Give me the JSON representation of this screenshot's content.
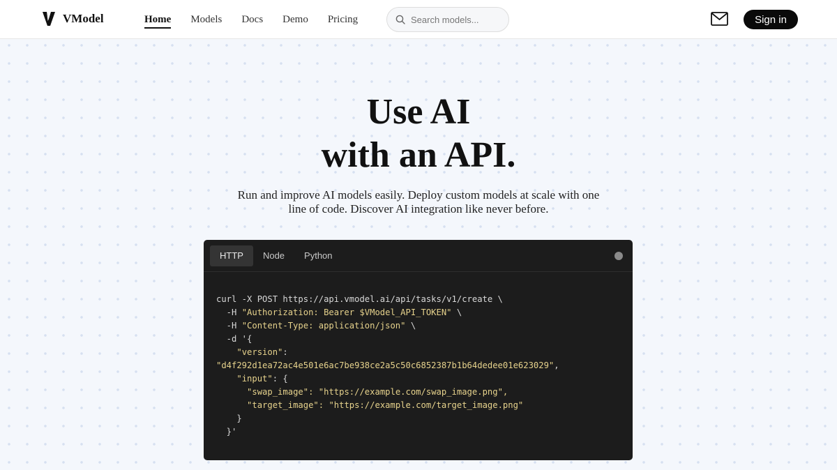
{
  "header": {
    "brand": "VModel",
    "nav": [
      {
        "label": "Home",
        "active": true
      },
      {
        "label": "Models",
        "active": false
      },
      {
        "label": "Docs",
        "active": false
      },
      {
        "label": "Demo",
        "active": false
      },
      {
        "label": "Pricing",
        "active": false
      }
    ],
    "search_placeholder": "Search models...",
    "mail_icon": "mail-icon",
    "signin_label": "Sign in"
  },
  "hero": {
    "title_line1": "Use AI",
    "title_line2": "with an API.",
    "subtitle": "Run and improve AI models easily. Deploy custom models at scale with one line of code. Discover AI integration like never before."
  },
  "code_panel": {
    "tabs": [
      {
        "label": "HTTP",
        "active": true
      },
      {
        "label": "Node",
        "active": false
      },
      {
        "label": "Python",
        "active": false
      }
    ],
    "lines": [
      {
        "pre": "curl -X POST https://api.vmodel.ai/api/tasks/v1/create \\",
        "str": "",
        "post": ""
      },
      {
        "pre": "  -H ",
        "str": "\"Authorization: Bearer $VModel_API_TOKEN\"",
        "post": " \\"
      },
      {
        "pre": "  -H ",
        "str": "\"Content-Type: application/json\"",
        "post": " \\"
      },
      {
        "pre": "  -d '{",
        "str": "",
        "post": ""
      },
      {
        "pre": "    ",
        "str": "\"version\"",
        "post": ":"
      },
      {
        "pre": "",
        "str": "\"d4f292d1ea72ac4e501e6ac7be938ce2a5c50c6852387b1b64dedee01e623029\"",
        "post": ","
      },
      {
        "pre": "    ",
        "str": "\"input\"",
        "post": ": {"
      },
      {
        "pre": "      ",
        "str": "\"swap_image\"",
        "post": ": \"https://example.com/swap_image.png\","
      },
      {
        "pre": "      ",
        "str": "\"target_image\"",
        "post": ": \"https://example.com/target_image.png\""
      },
      {
        "pre": "    }",
        "str": "",
        "post": ""
      },
      {
        "pre": "  }'",
        "str": "",
        "post": ""
      }
    ]
  },
  "colors": {
    "accent": "#0a0a0a",
    "code_bg": "#1c1c1c",
    "code_string": "#e6d28c"
  }
}
